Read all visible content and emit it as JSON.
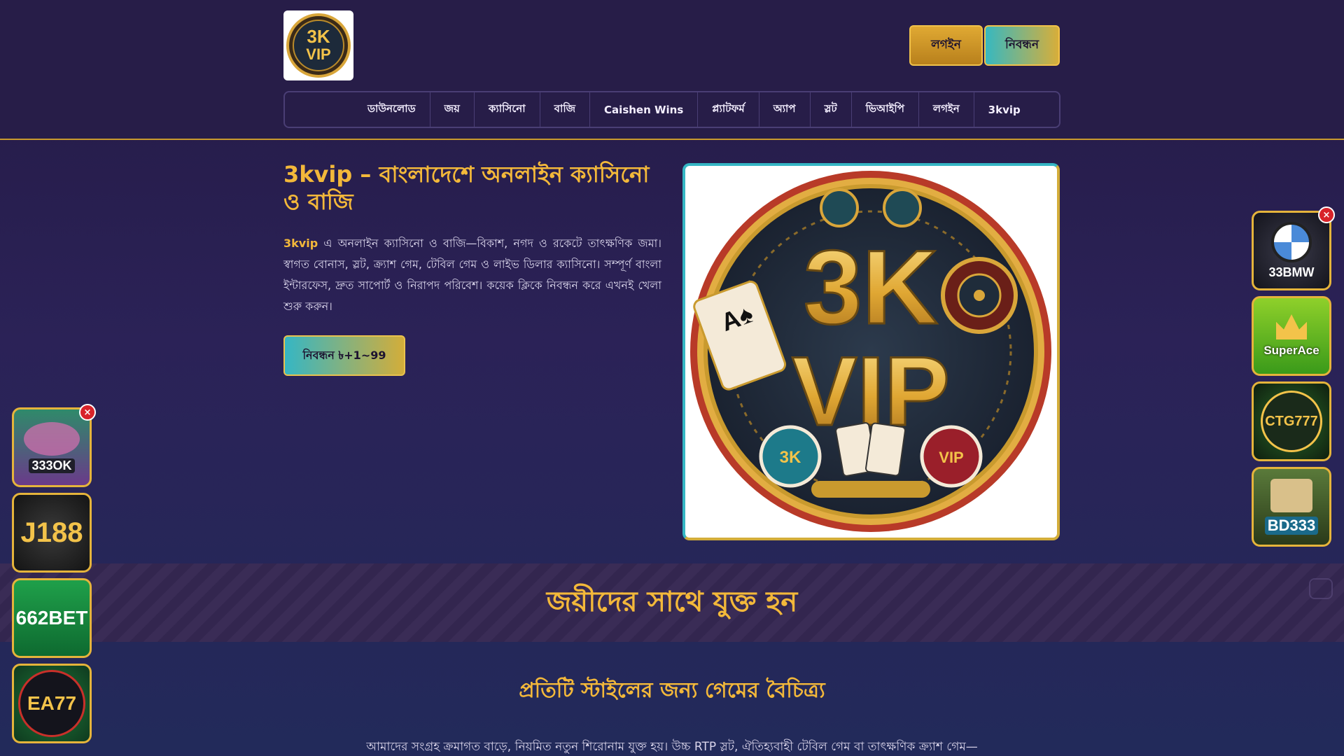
{
  "header": {
    "logo_alt": "3K VIP",
    "login_label": "লগইন",
    "register_label": "নিবন্ধন"
  },
  "nav": {
    "items": [
      {
        "label": "ডাউনলোড"
      },
      {
        "label": "জয়"
      },
      {
        "label": "ক্যাসিনো"
      },
      {
        "label": "বাজি"
      },
      {
        "label": "Caishen Wins"
      },
      {
        "label": "প্ল্যাটফর্ম"
      },
      {
        "label": "অ্যাপ"
      },
      {
        "label": "স্লট"
      },
      {
        "label": "ভিআইপি"
      },
      {
        "label": "লগইন"
      },
      {
        "label": "3kvip"
      }
    ]
  },
  "hero": {
    "title": "3kvip – বাংলাদেশে অনলাইন ক্যাসিনো ও বাজি",
    "brand": "3kvip",
    "description": " এ অনলাইন ক্যাসিনো ও বাজি—বিকাশ, নগদ ও রকেটে তাৎক্ষণিক জমা। স্বাগত বোনাস, স্লট, ক্র্যাশ গেম, টেবিল গেম ও লাইভ ডিলার ক্যাসিনো। সম্পূর্ণ বাংলা ইন্টারফেস, দ্রুত সাপোর্ট ও নিরাপদ পরিবেশ। কয়েক ক্লিকে নিবন্ধন করে এখনই খেলা শুরু করুন।",
    "cta_label": "নিবন্ধন ৳+1~99",
    "image_text_top": "3K",
    "image_text_bottom": "VIP"
  },
  "join": {
    "title": "জয়ীদের সাথে যুক্ত হন"
  },
  "games": {
    "title": "প্রতিটি স্টাইলের জন্য গেমের বৈচিত্র্য",
    "description": "আমাদের সংগ্রহ ক্রমাগত বাড়ে, নিয়মিত নতুন শিরোনাম যুক্ত হয়। উচ্চ RTP স্লট, ঐতিহ্যবাহী টেবিল গেম বা তাৎক্ষণিক ক্র্যাশ গেম—"
  },
  "left_ads": [
    {
      "label": "333OK"
    },
    {
      "label": "J188"
    },
    {
      "label": "662BET"
    },
    {
      "label": "EA77"
    }
  ],
  "right_ads": [
    {
      "label": "33BMW"
    },
    {
      "label": "SuperAce"
    },
    {
      "label": "CTG777"
    },
    {
      "label": "BD333"
    }
  ],
  "close_glyph": "×",
  "colors": {
    "accent_gold": "#f3b83a",
    "accent_teal": "#35b6c4",
    "background": "#2b2257",
    "close_red": "#d8232a"
  }
}
